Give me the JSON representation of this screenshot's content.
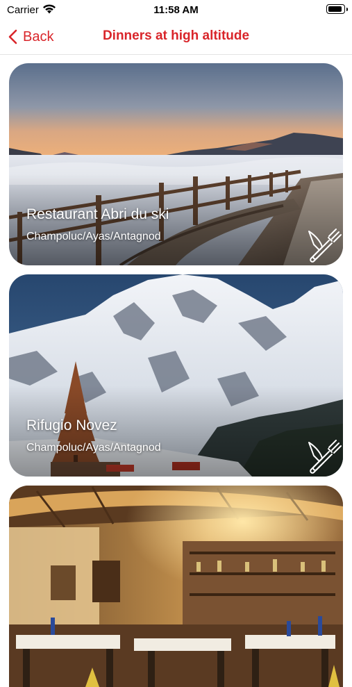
{
  "status_bar": {
    "carrier": "Carrier",
    "time": "11:58 AM"
  },
  "nav": {
    "back_label": "Back",
    "title": "Dinners at high altitude"
  },
  "colors": {
    "accent": "#d9252a",
    "card_text": "#ffffff"
  },
  "restaurants": [
    {
      "name": "Restaurant Abri du ski",
      "location": "Champoluc/Ayas/Antagnod",
      "icon": "cutlery-icon"
    },
    {
      "name": "Rifugio Novez",
      "location": "Champoluc/Ayas/Antagnod",
      "icon": "cutlery-icon"
    },
    {
      "name": "",
      "location": "",
      "icon": ""
    }
  ]
}
